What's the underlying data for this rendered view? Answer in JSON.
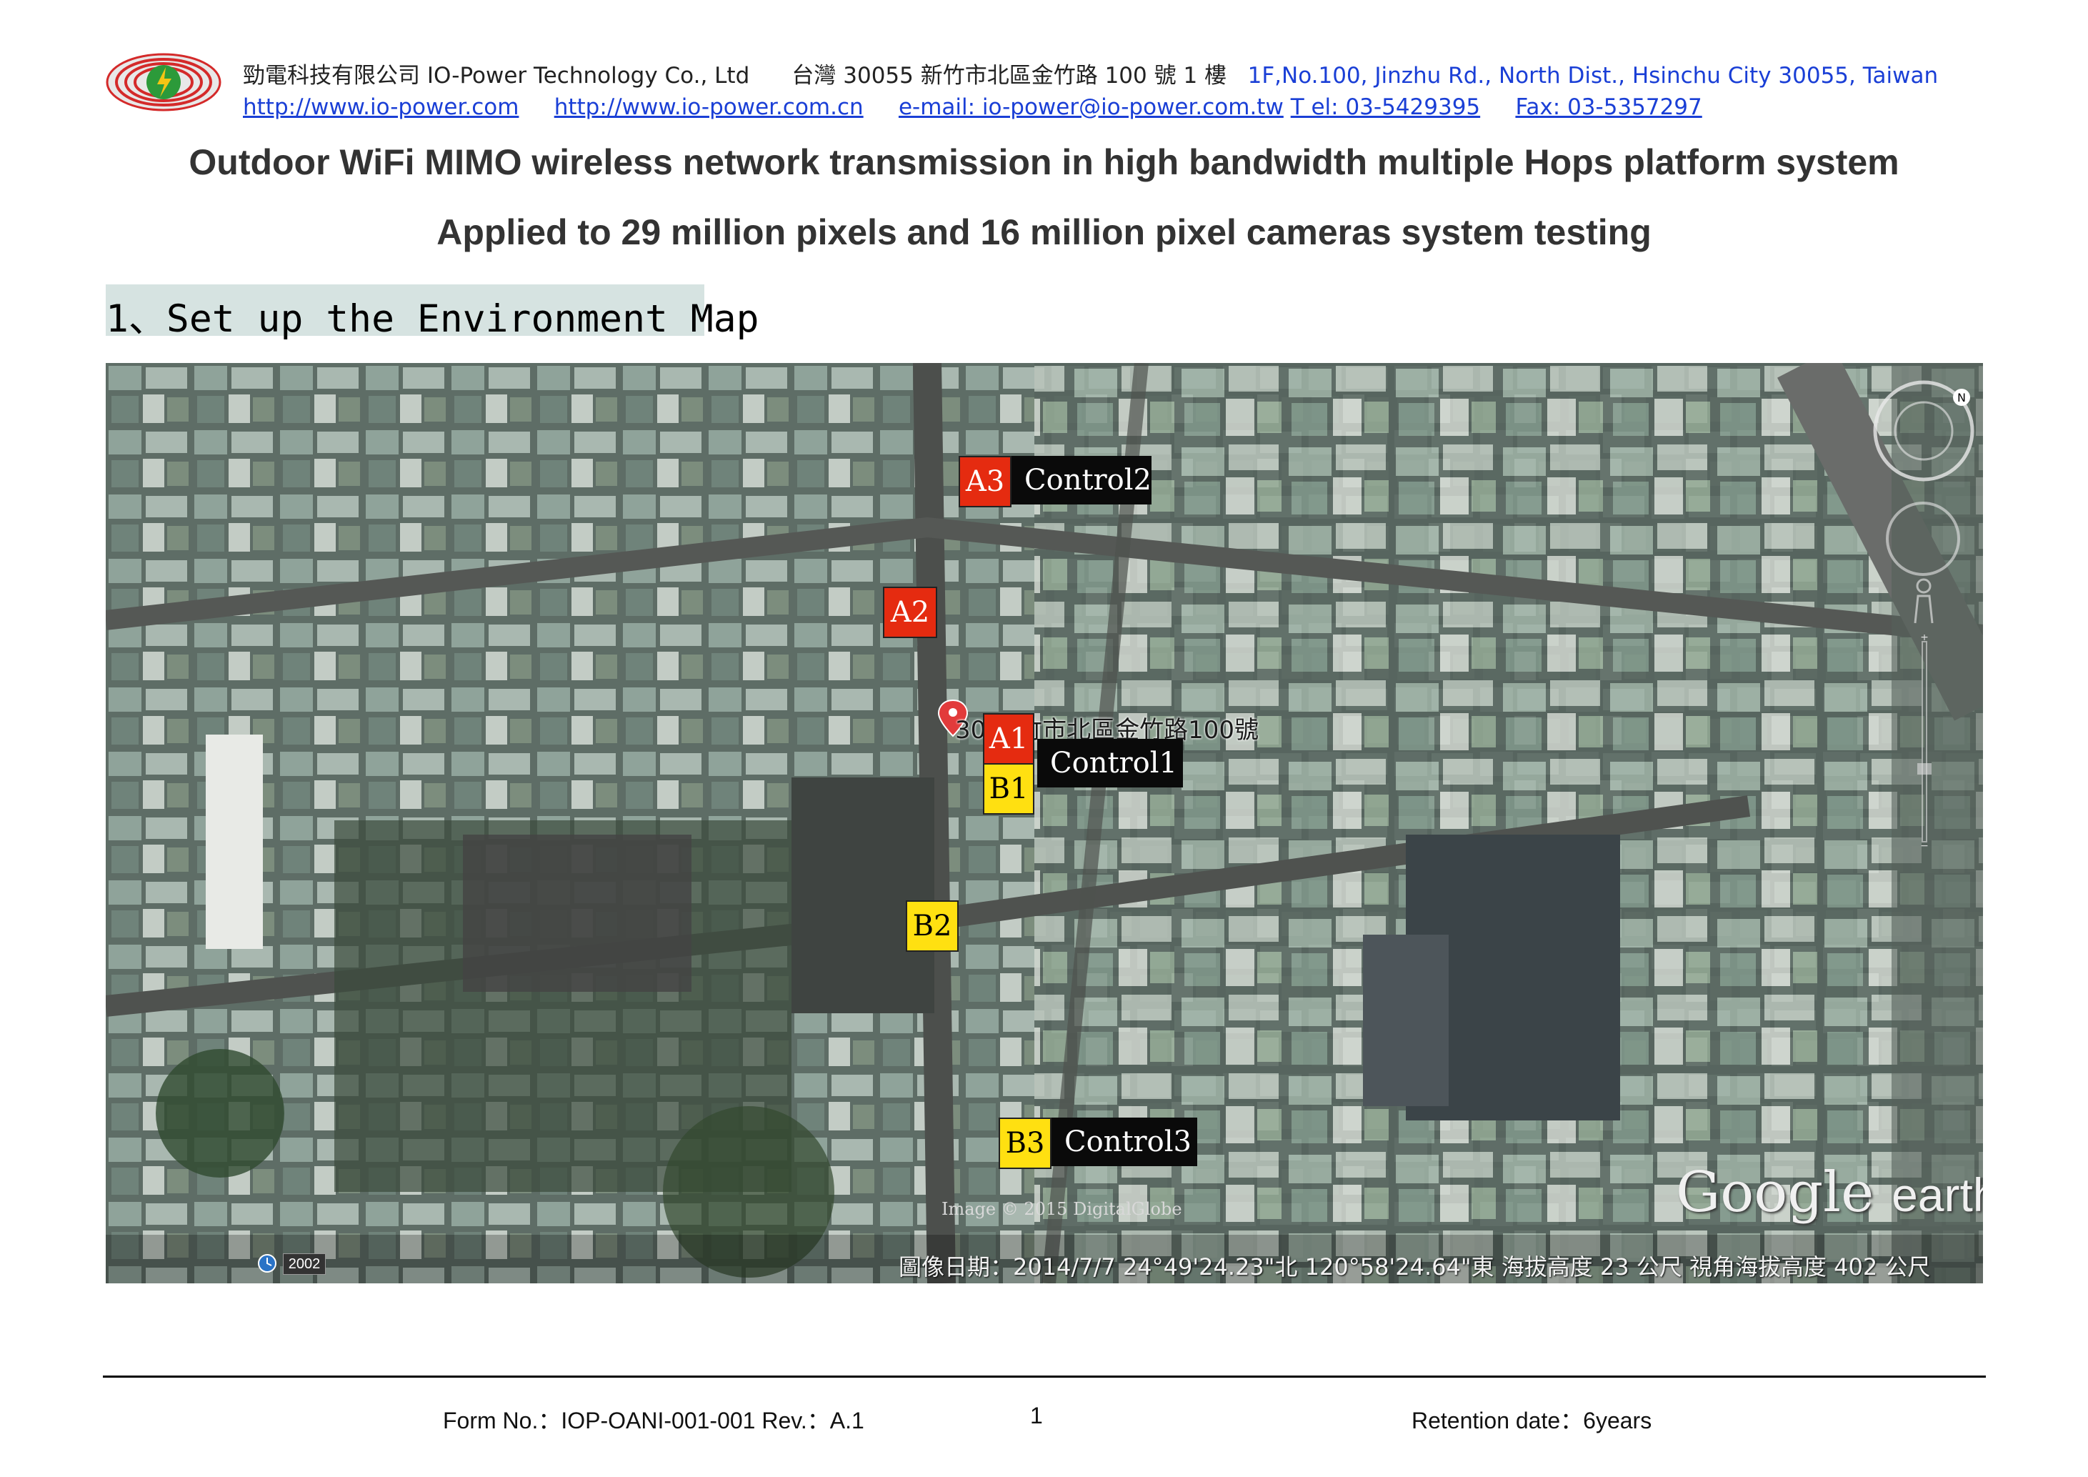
{
  "header": {
    "company_cn": "勁電科技有限公司",
    "company_en": "IO-Power Technology Co., Ltd",
    "address_cn": "台灣 30055 新竹市北區金竹路 100 號 1 樓",
    "address_en": "1F,No.100, Jinzhu Rd., North Dist., Hsinchu City 30055, Taiwan",
    "url1": "http://www.io-power.com",
    "url2": "http://www.io-power.com.cn",
    "email": "e-mail: io-power@io-power.com.tw",
    "tel": "T el: 03-5429395",
    "fax": "Fax: 03-5357297"
  },
  "title_line1": "Outdoor WiFi MIMO wireless network transmission in high bandwidth multiple Hops platform system",
  "title_line2": "Applied to 29 million pixels and 16 million pixel cameras system testing",
  "section_heading": "1、Set up the Environment Map",
  "map": {
    "markers": {
      "a1": "A1",
      "a2": "A2",
      "a3": "A3",
      "b1": "B1",
      "b2": "B2",
      "b3": "B3"
    },
    "controls": {
      "control1": "Control1",
      "control2": "Control2",
      "control3": "Control3"
    },
    "address_label": "30 新竹市北區金竹路100號",
    "image_credit": "Image © 2015 DigitalGlobe",
    "logo_google": "Google",
    "logo_earth": "earth",
    "year_badge": "2002",
    "status_bar": "圖像日期：2014/7/7    24°49'24.23\"北  120°58'24.64\"東  海拔高度   23 公尺    視角海拔高度   402 公尺",
    "colors": {
      "a_marker": "#e52b10",
      "b_marker": "#ffe011",
      "control_bg": "#0a0a0a"
    }
  },
  "footer": {
    "form_no": "Form No.：IOP-OANI-001-001    Rev.：A.1",
    "page": "1",
    "retention": "Retention date：6years"
  }
}
